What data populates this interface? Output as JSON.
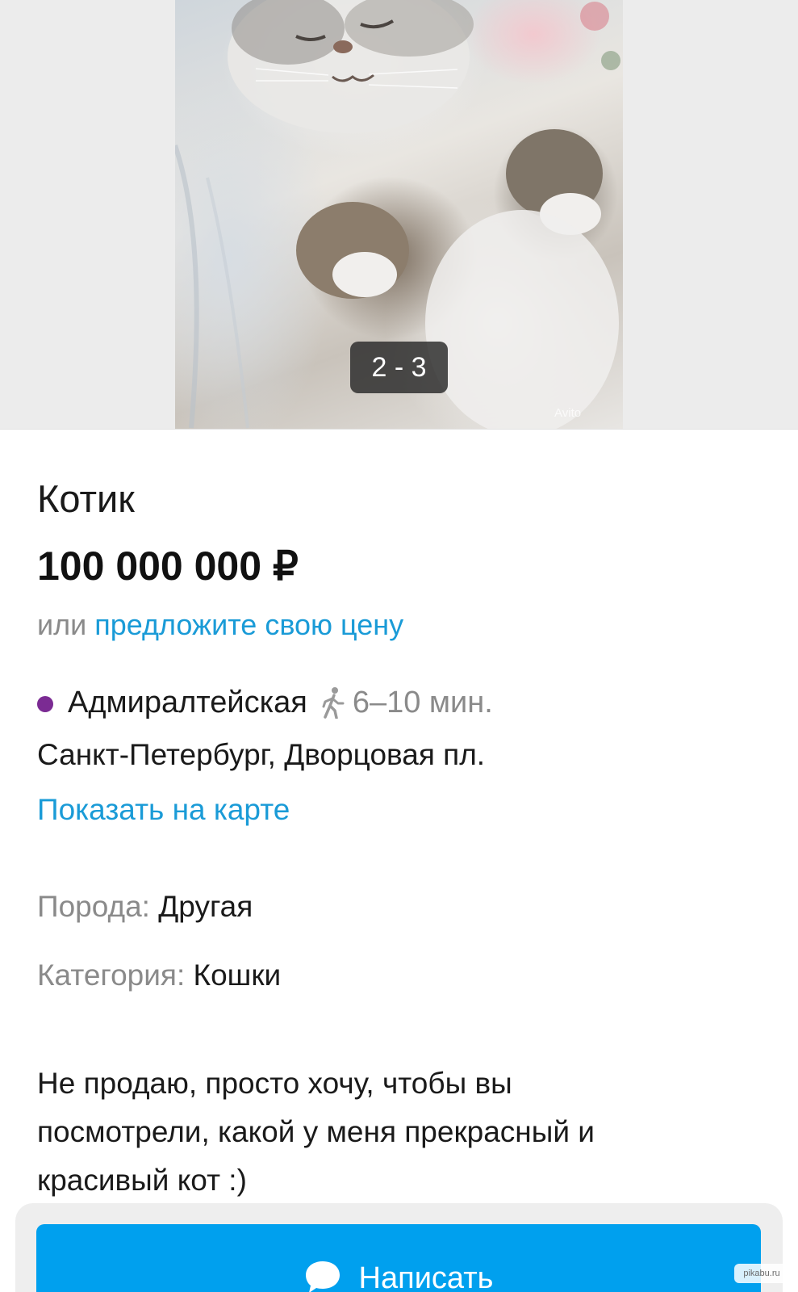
{
  "gallery": {
    "counter": "2 - 3",
    "watermark": "Avito"
  },
  "listing": {
    "title": "Котик",
    "price": "100 000 000 ₽",
    "offer_prefix": "или ",
    "offer_link": "предложите свою цену",
    "metro_station": "Адмиралтейская",
    "metro_line_color": "#7b2b93",
    "walk_time": "6–10 мин.",
    "address": "Санкт-Петербург, Дворцовая пл.",
    "map_link": "Показать на карте",
    "params": [
      {
        "label": "Порода: ",
        "value": "Другая"
      },
      {
        "label": "Категория: ",
        "value": "Кошки"
      }
    ],
    "description_lines": [
      "Не продаю, просто хочу, чтобы вы",
      "посмотрели, какой у меня прекрасный и",
      "красивый кот :)"
    ]
  },
  "actions": {
    "write_label": "Написать",
    "write_icon": "chat-bubble-icon",
    "accent_color": "#00a0ee"
  },
  "overlay": {
    "source_watermark": "pikabu.ru"
  }
}
